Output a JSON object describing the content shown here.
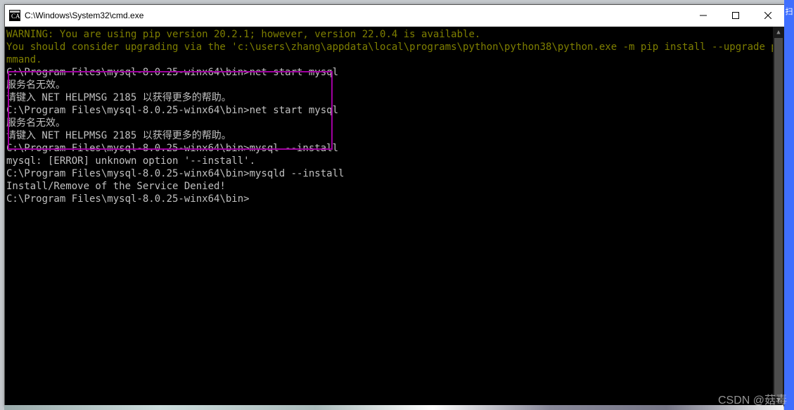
{
  "window": {
    "title": "C:\\Windows\\System32\\cmd.exe"
  },
  "yellow_lines": [
    "WARNING: You are using pip version 20.2.1; however, version 22.0.4 is available.",
    "You should consider upgrading via the 'c:\\users\\zhang\\appdata\\local\\programs\\python\\python38\\python.exe -m pip install --upgrade pip' co",
    "mmand."
  ],
  "blocks": [
    {
      "prompt": "C:\\Program Files\\mysql-8.0.25-winx64\\bin>",
      "cmd": "net start mysql",
      "out": [
        "服务名无效。",
        "",
        "请键入 NET HELPMSG 2185 以获得更多的帮助。",
        ""
      ]
    },
    {
      "prompt": "C:\\Program Files\\mysql-8.0.25-winx64\\bin>",
      "cmd": "net start mysql",
      "out": [
        "服务名无效。",
        "",
        "请键入 NET HELPMSG 2185 以获得更多的帮助。",
        ""
      ]
    },
    {
      "prompt": "C:\\Program Files\\mysql-8.0.25-winx64\\bin>",
      "cmd": "mysql --install",
      "out": [
        "mysql: [ERROR] unknown option '--install'."
      ]
    },
    {
      "prompt": "C:\\Program Files\\mysql-8.0.25-winx64\\bin>",
      "cmd": "mysqld --install",
      "out": [
        "Install/Remove of the Service Denied!"
      ]
    },
    {
      "prompt": "C:\\Program Files\\mysql-8.0.25-winx64\\bin>",
      "cmd": "",
      "out": []
    }
  ],
  "watermark": "CSDN @菇毒",
  "side_tab": "扫"
}
